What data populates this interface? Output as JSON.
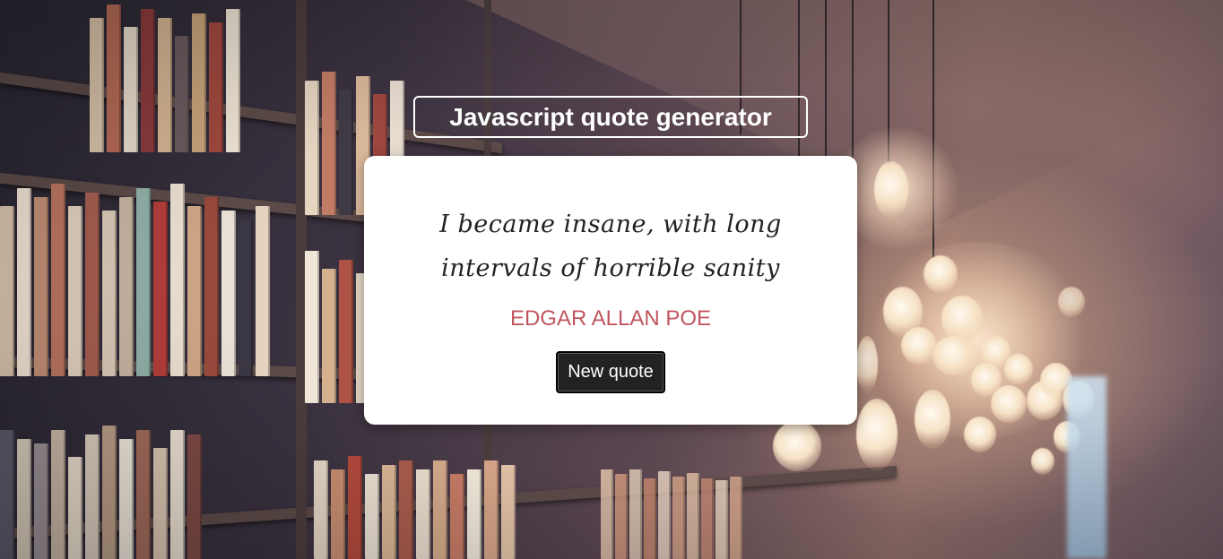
{
  "app": {
    "title": "Javascript quote generator"
  },
  "quote": {
    "text": "I became insane, with long intervals of horrible sanity",
    "author": "EDGAR ALLAN POE"
  },
  "controls": {
    "new_quote_label": "New quote"
  },
  "colors": {
    "author": "#c0565f",
    "button_bg": "#222222",
    "card_bg": "#ffffff",
    "title_border": "#ffffff"
  },
  "icons": {
    "background": "library-bookshelf-photo"
  }
}
